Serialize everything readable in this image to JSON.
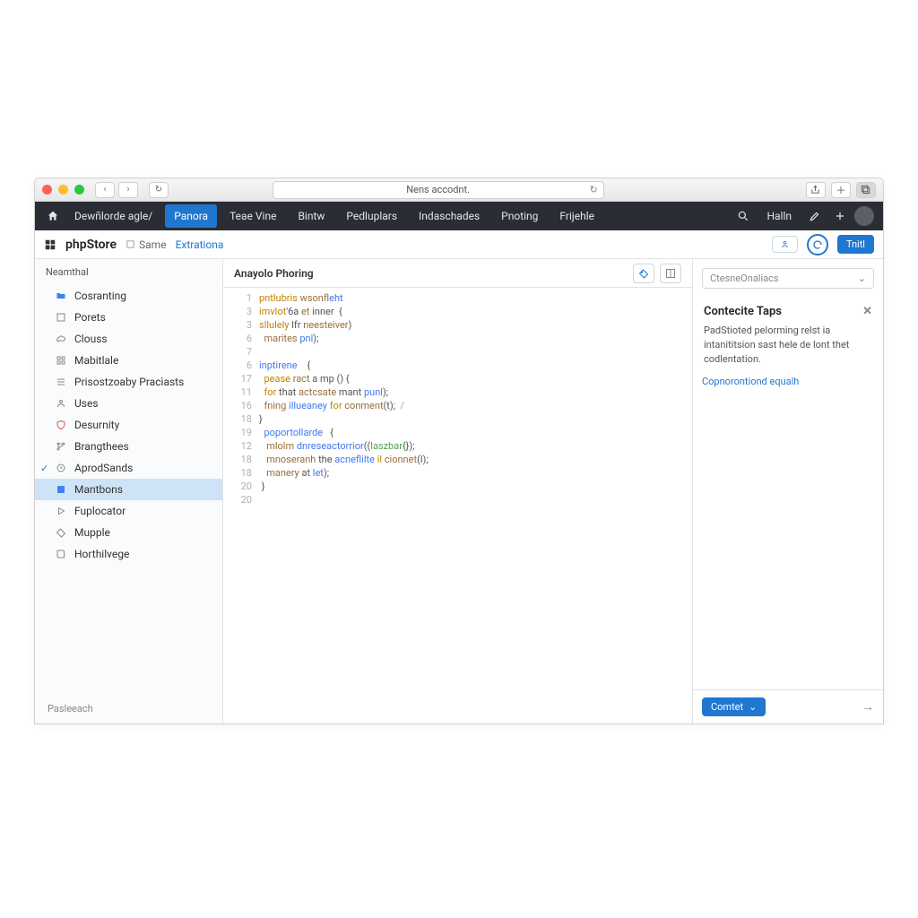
{
  "browser": {
    "url_display": "Nens accodnt.",
    "back_icon": "‹",
    "fwd_icon": "›",
    "reload_icon": "↻"
  },
  "topnav": {
    "items": [
      {
        "label": "Dewñlorde agle/",
        "active": false
      },
      {
        "label": "Panora",
        "active": true
      },
      {
        "label": "Teae Vine",
        "active": false
      },
      {
        "label": "Bintw",
        "active": false
      },
      {
        "label": "Pedluplars",
        "active": false
      },
      {
        "label": "Indaschades",
        "active": false
      },
      {
        "label": "Pnoting",
        "active": false
      },
      {
        "label": "Frijehle",
        "active": false
      }
    ],
    "search_label": "",
    "user_label": "Halln"
  },
  "subheader": {
    "logo": "phpStore",
    "same_label": "Same",
    "link_label": "Extrationa",
    "share_btn": "",
    "primary_btn": "Tnitl"
  },
  "sidebar": {
    "header": "Neamthal",
    "items": [
      {
        "icon": "folder-icon",
        "color": "#3b82f6",
        "label": "Cosranting"
      },
      {
        "icon": "box-icon",
        "color": "#888",
        "label": "Porets"
      },
      {
        "icon": "cloud-icon",
        "color": "#888",
        "label": "Clouss"
      },
      {
        "icon": "grid-icon",
        "color": "#888",
        "label": "Mabitlale"
      },
      {
        "icon": "list-icon",
        "color": "#888",
        "label": "Prisostzoaby Pracìasts"
      },
      {
        "icon": "user-icon",
        "color": "#888",
        "label": "Uses"
      },
      {
        "icon": "shield-icon",
        "color": "#e05555",
        "label": "Desurnity"
      },
      {
        "icon": "branch-icon",
        "color": "#888",
        "label": "Brangthees"
      },
      {
        "icon": "clock-icon",
        "color": "#888",
        "label": "AprodSands",
        "checked": true
      },
      {
        "icon": "module-icon",
        "color": "#3b82f6",
        "label": "Mantbons",
        "selected": true
      },
      {
        "icon": "play-icon",
        "color": "#888",
        "label": "Fuplocator"
      },
      {
        "icon": "tag-icon",
        "color": "#888",
        "label": "Mupple"
      },
      {
        "icon": "book-icon",
        "color": "#888",
        "label": "Horthilvege"
      }
    ],
    "footer": "Pasleeach"
  },
  "main": {
    "title": "Anayolo Phoring",
    "gutter": [
      "1",
      "3",
      "3",
      "6",
      "7",
      "6",
      "17",
      "11",
      "16",
      "18",
      "19",
      "12",
      "18",
      "18",
      "20",
      "20"
    ],
    "code": [
      [
        {
          "c": "tok-kw",
          "t": "pntlubris "
        },
        {
          "c": "tok-fn",
          "t": "wsonf"
        },
        {
          "c": "tok-id",
          "t": "leht"
        }
      ],
      [
        {
          "c": "tok-kw",
          "t": "imvlot"
        },
        {
          "c": "tok-pn",
          "t": "'6a "
        },
        {
          "c": "tok-fn",
          "t": "et"
        },
        {
          "c": "tok-pn",
          "t": " inner  {"
        }
      ],
      [
        {
          "c": "tok-kw",
          "t": "sllulely "
        },
        {
          "c": "tok-pn",
          "t": "lfr "
        },
        {
          "c": "tok-fn",
          "t": "neesteiver"
        },
        {
          "c": "tok-pn",
          "t": ")"
        }
      ],
      [
        {
          "c": "tok-pn",
          "t": "  "
        },
        {
          "c": "tok-fn",
          "t": "marites "
        },
        {
          "c": "tok-id",
          "t": "pnl"
        },
        {
          "c": "tok-pn",
          "t": ");"
        }
      ],
      [
        {
          "c": "tok-pn",
          "t": ""
        }
      ],
      [
        {
          "c": "tok-id",
          "t": "inptirene"
        },
        {
          "c": "tok-pn",
          "t": "    {"
        }
      ],
      [
        {
          "c": "tok-pn",
          "t": "  "
        },
        {
          "c": "tok-kw",
          "t": "pease "
        },
        {
          "c": "tok-fn",
          "t": "ract "
        },
        {
          "c": "tok-pn",
          "t": "a mp () {"
        }
      ],
      [
        {
          "c": "tok-pn",
          "t": "  "
        },
        {
          "c": "tok-kw",
          "t": "for "
        },
        {
          "c": "tok-pn",
          "t": "that "
        },
        {
          "c": "tok-fn",
          "t": "actcsate "
        },
        {
          "c": "tok-pn",
          "t": "mant "
        },
        {
          "c": "tok-id",
          "t": "punl"
        },
        {
          "c": "tok-pn",
          "t": ");"
        }
      ],
      [
        {
          "c": "tok-pn",
          "t": "  "
        },
        {
          "c": "tok-fn",
          "t": "fning "
        },
        {
          "c": "tok-id",
          "t": "illueaney "
        },
        {
          "c": "tok-kw",
          "t": "for "
        },
        {
          "c": "tok-fn",
          "t": "conment"
        },
        {
          "c": "tok-pn",
          "t": "(t);  "
        },
        {
          "c": "tok-cm",
          "t": "/"
        }
      ],
      [
        {
          "c": "tok-pn",
          "t": "}"
        }
      ],
      [
        {
          "c": "tok-pn",
          "t": "  "
        },
        {
          "c": "tok-id",
          "t": "poportollarde"
        },
        {
          "c": "tok-pn",
          "t": "   {"
        }
      ],
      [
        {
          "c": "tok-pn",
          "t": "   "
        },
        {
          "c": "tok-fn",
          "t": "mlolm "
        },
        {
          "c": "tok-id",
          "t": "dnreseactorrior"
        },
        {
          "c": "tok-pn",
          "t": "(("
        },
        {
          "c": "tok-str",
          "t": "laszbar"
        },
        {
          "c": "tok-pn",
          "t": "{});"
        }
      ],
      [
        {
          "c": "tok-pn",
          "t": "   "
        },
        {
          "c": "tok-fn",
          "t": "mnoseranh "
        },
        {
          "c": "tok-pn",
          "t": "the "
        },
        {
          "c": "tok-id",
          "t": "acneflilte "
        },
        {
          "c": "tok-kw",
          "t": "il "
        },
        {
          "c": "tok-fn",
          "t": "cionnet"
        },
        {
          "c": "tok-pn",
          "t": "(l);"
        }
      ],
      [
        {
          "c": "tok-pn",
          "t": "   "
        },
        {
          "c": "tok-fn",
          "t": "manery "
        },
        {
          "c": "tok-pn",
          "t": "at "
        },
        {
          "c": "tok-id",
          "t": "let"
        },
        {
          "c": "tok-pn",
          "t": ");"
        }
      ],
      [
        {
          "c": "tok-pn",
          "t": " }"
        }
      ],
      [
        {
          "c": "tok-pn",
          "t": ""
        }
      ]
    ]
  },
  "right": {
    "dropdown": "CtesneOnaliacs",
    "card_title": "Contecite Taps",
    "card_body": "PadStioted pelorming relst ia intanititsion sast hele de lont thet codlentation.",
    "card_link": "Copnorontiond equalh",
    "footer_btn": "Comtet"
  }
}
